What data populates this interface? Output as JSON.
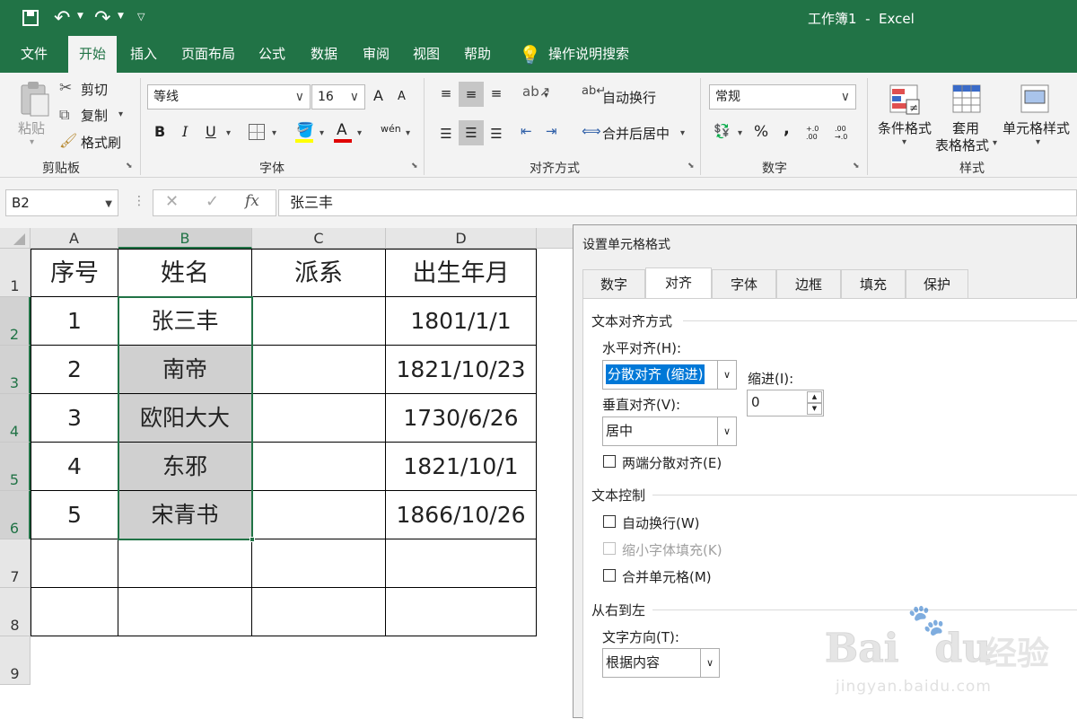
{
  "titlebar": {
    "title": "工作簿1  -  Excel"
  },
  "tabs": [
    "文件",
    "开始",
    "插入",
    "页面布局",
    "公式",
    "数据",
    "审阅",
    "视图",
    "帮助"
  ],
  "tell_me": "操作说明搜索",
  "ribbon": {
    "clipboard": {
      "paste": "粘贴",
      "cut": "剪切",
      "copy": "复制",
      "format_painter": "格式刷",
      "label": "剪贴板"
    },
    "font": {
      "name": "等线",
      "size": "16",
      "label": "字体",
      "grow": "A",
      "shrink": "A",
      "bold": "B",
      "italic": "I",
      "underline": "U",
      "font_color": "A",
      "phonetic": "wén"
    },
    "alignment": {
      "wrap": "自动换行",
      "merge": "合并后居中",
      "label": "对齐方式"
    },
    "number": {
      "format": "常规",
      "percent": "%",
      "comma": ",",
      "inc": "+.0 .00",
      "dec": ".00 →.0",
      "label": "数字"
    },
    "styles": {
      "conditional": "条件格式",
      "table_1": "套用",
      "table_2": "表格格式",
      "cell_styles": "单元格样式",
      "label": "样式"
    }
  },
  "formula_bar": {
    "name_box": "B2",
    "fx": "fx",
    "cancel": "✕",
    "confirm": "✓",
    "value": "张三丰"
  },
  "sheet": {
    "columns": [
      "A",
      "B",
      "C",
      "D"
    ],
    "rows": [
      "1",
      "2",
      "3",
      "4",
      "5",
      "6",
      "7",
      "8",
      "9"
    ],
    "data": [
      [
        "序号",
        "姓名",
        "派系",
        "出生年月"
      ],
      [
        "1",
        "张三丰",
        "",
        "1801/1/1"
      ],
      [
        "2",
        "南帝",
        "",
        "1821/10/23"
      ],
      [
        "3",
        "欧阳大大",
        "",
        "1730/6/26"
      ],
      [
        "4",
        "东邪",
        "",
        "1821/10/1"
      ],
      [
        "5",
        "宋青书",
        "",
        "1866/10/26"
      ],
      [
        "",
        "",
        "",
        ""
      ],
      [
        "",
        "",
        "",
        ""
      ]
    ]
  },
  "dialog": {
    "title": "设置单元格格式",
    "tabs": [
      "数字",
      "对齐",
      "字体",
      "边框",
      "填充",
      "保护"
    ],
    "section_align": "文本对齐方式",
    "horizontal_label": "水平对齐(H):",
    "horizontal_value": "分散对齐 (缩进)",
    "indent_label": "缩进(I):",
    "indent_value": "0",
    "vertical_label": "垂直对齐(V):",
    "vertical_value": "居中",
    "justify_distributed": "两端分散对齐(E)",
    "section_control": "文本控制",
    "wrap_text": "自动换行(W)",
    "shrink_to_fit": "缩小字体填充(K)",
    "merge_cells": "合并单元格(M)",
    "section_rtl": "从右到左",
    "direction_label": "文字方向(T):",
    "direction_value": "根据内容"
  },
  "watermark": {
    "brand": "Bai",
    "brand2": "du",
    "cn": "经验",
    "url": "jingyan.baidu.com"
  },
  "colors": {
    "excel_green": "#217346",
    "selection": "#d0d0d0",
    "highlight": "#0078d7"
  }
}
